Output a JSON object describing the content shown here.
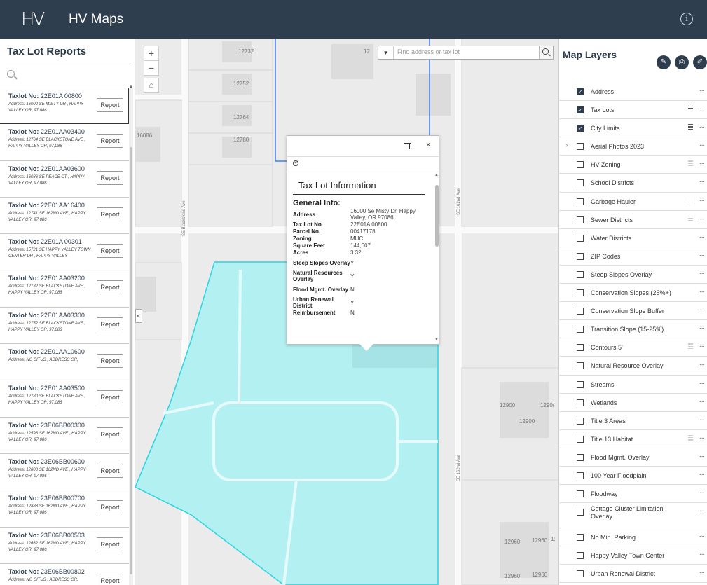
{
  "header": {
    "logo": "HV",
    "title": "HV Maps",
    "info_icon": "info-icon"
  },
  "left_panel": {
    "title": "Tax Lot Reports",
    "search_placeholder": "",
    "report_label": "Report",
    "items": [
      {
        "label": "Taxlot No:",
        "no": "22E01A 00800",
        "address": "Address: 16000 SE MISTY DR , HAPPY VALLEY OR, 97,086"
      },
      {
        "label": "Taxlot No:",
        "no": "22E01AA03400",
        "address": "Address: 12764 SE BLACKSTONE AVE , HAPPY VALLEY OR, 97,086"
      },
      {
        "label": "Taxlot No:",
        "no": "22E01AA03600",
        "address": "Address: 16086 SE PEACE CT , HAPPY VALLEY OR, 97,086"
      },
      {
        "label": "Taxlot No:",
        "no": "22E01AA16400",
        "address": "Address: 12741 SE 162ND AVE , HAPPY VALLEY OR, 97,086"
      },
      {
        "label": "Taxlot No:",
        "no": "22E01A 00301",
        "address": "Address: 15721 SE HAPPY VALLEY TOWN CENTER DR , HAPPY VALLEY"
      },
      {
        "label": "Taxlot No:",
        "no": "22E01AA03200",
        "address": "Address: 12732 SE BLACKSTONE AVE , HAPPY VALLEY OR, 97,086"
      },
      {
        "label": "Taxlot No:",
        "no": "22E01AA03300",
        "address": "Address: 12752 SE BLACKSTONE AVE , HAPPY VALLEY OR, 97,086"
      },
      {
        "label": "Taxlot No:",
        "no": "22E01AA10600",
        "address": "Address: NO SITUS , ADDRESS OR,"
      },
      {
        "label": "Taxlot No:",
        "no": "22E01AA03500",
        "address": "Address: 12780 SE BLACKSTONE AVE , HAPPY VALLEY OR, 97,086"
      },
      {
        "label": "Taxlot No:",
        "no": "23E06BB00300",
        "address": "Address: 12596 SE 162ND AVE , HAPPY VALLEY OR, 97,086"
      },
      {
        "label": "Taxlot No:",
        "no": "23E06BB00600",
        "address": "Address: 12800 SE 162ND AVE , HAPPY VALLEY OR, 97,086"
      },
      {
        "label": "Taxlot No:",
        "no": "23E06BB00700",
        "address": "Address: 12888 SE 162ND AVE , HAPPY VALLEY OR, 97,086"
      },
      {
        "label": "Taxlot No:",
        "no": "23E06BB00503",
        "address": "Address: 12662 SE 162ND AVE , HAPPY VALLEY OR, 97,086"
      },
      {
        "label": "Taxlot No:",
        "no": "23E06BB00802",
        "address": "Address: NO SITUS , ADDRESS OR,"
      }
    ]
  },
  "map": {
    "search_placeholder": "Find address or tax lot",
    "zoom_in": "+",
    "zoom_out": "−",
    "collapse": "<",
    "lot_labels": [
      "12732",
      "12",
      "12752",
      "12764",
      "12780",
      "16086",
      "12900",
      "1290(",
      "12900",
      "12960",
      "12960",
      "1:",
      "12960",
      "12960"
    ],
    "road_labels": [
      "SE Blackstone Ave",
      "SE 162nd Ave",
      "SE 162nd Ave"
    ],
    "colors": {
      "water_fill": "#b3f0f1",
      "water_stroke": "#2ad4e0",
      "city_line": "#3f7ff0",
      "background": "#ebebeb",
      "building": "#dcdcdc"
    }
  },
  "popup": {
    "title": "Tax Lot Information",
    "section": "General Info:",
    "rows": [
      {
        "key": "Address",
        "value": "16000 Se Misty Dr, Happy Valley, OR 97086"
      },
      {
        "key": "Tax Lot No.",
        "value": "22E01A 00800"
      },
      {
        "key": "Parcel No.",
        "value": "00417178"
      },
      {
        "key": "Zoning",
        "value": "MUC"
      },
      {
        "key": "Square Feet",
        "value": "144,607"
      },
      {
        "key": "Acres",
        "value": "3.32"
      },
      {
        "key": "Steep Slopes Overlay",
        "value": "Y"
      },
      {
        "key": "Natural Resources Overlay",
        "value": "Y"
      },
      {
        "key": "Flood Mgmt. Overlay",
        "value": "N"
      },
      {
        "key": "Urban Renewal District",
        "value": "Y"
      },
      {
        "key": "Reimbursement",
        "value": "N"
      }
    ]
  },
  "right_panel": {
    "title": "Map Layers",
    "layers": [
      {
        "label": "Address",
        "checked": true,
        "legend": false
      },
      {
        "label": "Tax Lots",
        "checked": true,
        "legend": "dark"
      },
      {
        "label": "City Limits",
        "checked": true,
        "legend": "dark"
      },
      {
        "label": "Aerial Photos 2023",
        "checked": false,
        "legend": false,
        "expand": true
      },
      {
        "label": "HV Zoning",
        "checked": false,
        "legend": "light"
      },
      {
        "label": "School Districts",
        "checked": false,
        "legend": false
      },
      {
        "label": "Garbage Hauler",
        "checked": false,
        "legend": "light"
      },
      {
        "label": "Sewer Districts",
        "checked": false,
        "legend": "light"
      },
      {
        "label": "Water Districts",
        "checked": false,
        "legend": false
      },
      {
        "label": "ZIP Codes",
        "checked": false,
        "legend": false
      },
      {
        "label": "Steep Slopes Overlay",
        "checked": false,
        "legend": false
      },
      {
        "label": "Conservation Slopes (25%+)",
        "checked": false,
        "legend": false
      },
      {
        "label": "Conservation Slope Buffer",
        "checked": false,
        "legend": false
      },
      {
        "label": "Transition Slope (15-25%)",
        "checked": false,
        "legend": false
      },
      {
        "label": "Contours 5'",
        "checked": false,
        "legend": "light"
      },
      {
        "label": "Natural Resource Overlay",
        "checked": false,
        "legend": false
      },
      {
        "label": "Streams",
        "checked": false,
        "legend": false
      },
      {
        "label": "Wetlands",
        "checked": false,
        "legend": false
      },
      {
        "label": "Title 3 Areas",
        "checked": false,
        "legend": false
      },
      {
        "label": "Title 13 Habitat",
        "checked": false,
        "legend": "light"
      },
      {
        "label": "Flood Mgmt. Overlay",
        "checked": false,
        "legend": false
      },
      {
        "label": "100 Year Floodplain",
        "checked": false,
        "legend": false
      },
      {
        "label": "Floodway",
        "checked": false,
        "legend": false
      },
      {
        "label": "Cottage Cluster Limitation Overlay",
        "checked": false,
        "legend": false,
        "two_line": true
      },
      {
        "label": "No Min. Parking",
        "checked": false,
        "legend": false
      },
      {
        "label": "Happy Valley Town Center",
        "checked": false,
        "legend": false
      },
      {
        "label": "Urban Renewal District",
        "checked": false,
        "legend": false
      }
    ]
  }
}
